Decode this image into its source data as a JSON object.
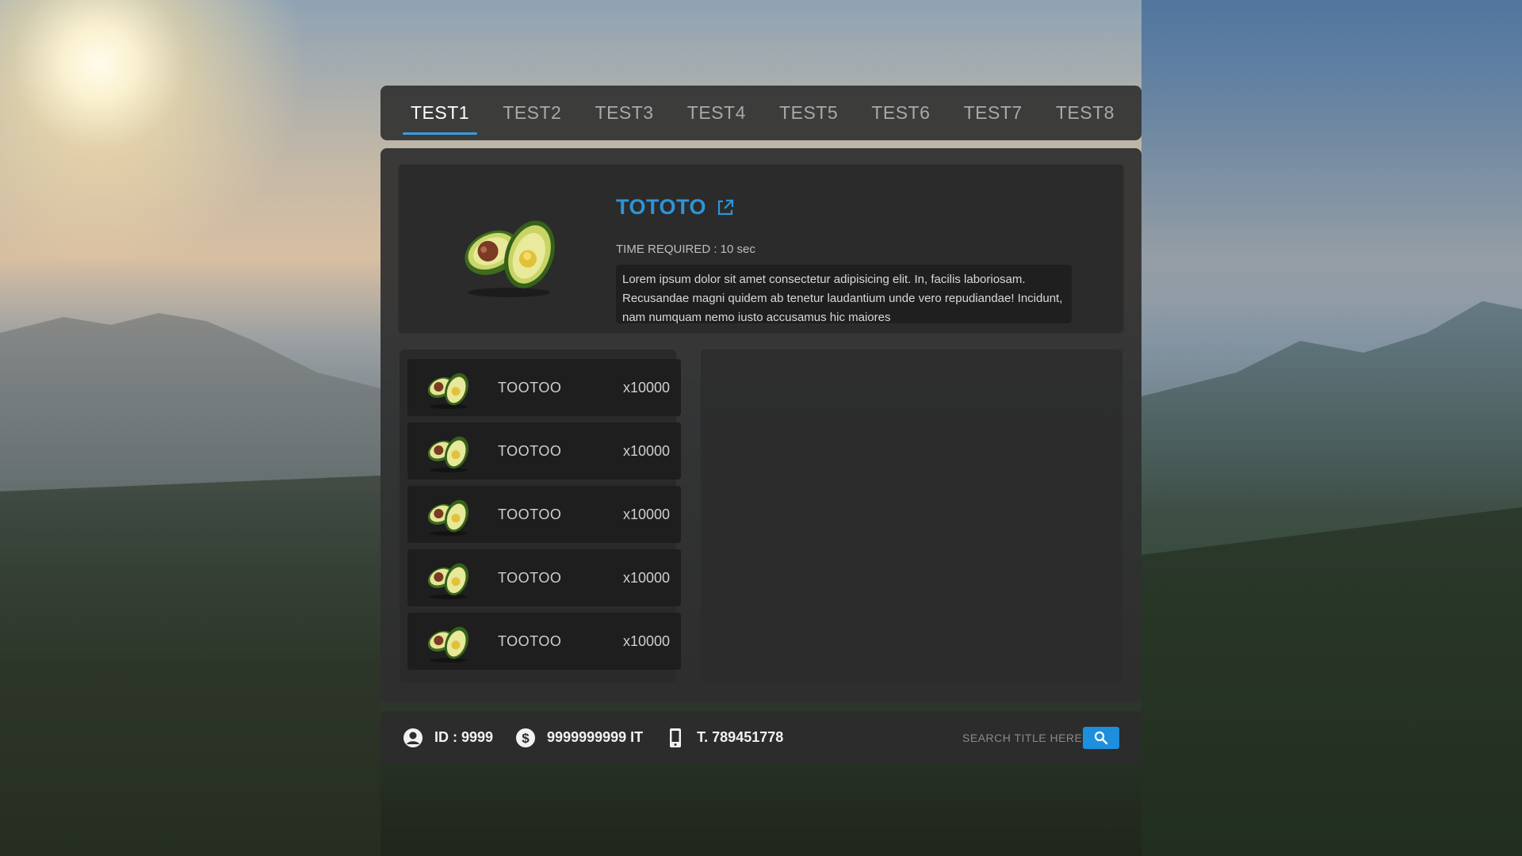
{
  "tabs": [
    {
      "label": "TEST1",
      "active": true
    },
    {
      "label": "TEST2",
      "active": false
    },
    {
      "label": "TEST3",
      "active": false
    },
    {
      "label": "TEST4",
      "active": false
    },
    {
      "label": "TEST5",
      "active": false
    },
    {
      "label": "TEST6",
      "active": false
    },
    {
      "label": "TEST7",
      "active": false
    },
    {
      "label": "TEST8",
      "active": false
    }
  ],
  "detail": {
    "title": "TOTOTO",
    "time_required": "TIME REQUIRED : 10 sec",
    "description": "Lorem ipsum dolor sit amet consectetur adipisicing elit. In, facilis laboriosam. Recusandae magni quidem ab tenetur laudantium unde vero repudiandae! Incidunt, nam numquam nemo iusto accusamus hic maiores",
    "image_icon": "avocado-icon"
  },
  "items": [
    {
      "name": "TOOTOO",
      "qty": "x10000"
    },
    {
      "name": "TOOTOO",
      "qty": "x10000"
    },
    {
      "name": "TOOTOO",
      "qty": "x10000"
    },
    {
      "name": "TOOTOO",
      "qty": "x10000"
    },
    {
      "name": "TOOTOO",
      "qty": "x10000"
    }
  ],
  "footer": {
    "id_text": "ID : 9999",
    "money_text": "9999999999 IT",
    "phone_text": "T. 789451778",
    "search_placeholder": "SEARCH TITLE HERE"
  },
  "colors": {
    "accent": "#2e95d8",
    "panel": "#2e2e2e",
    "search_button": "#1e8fdc"
  }
}
